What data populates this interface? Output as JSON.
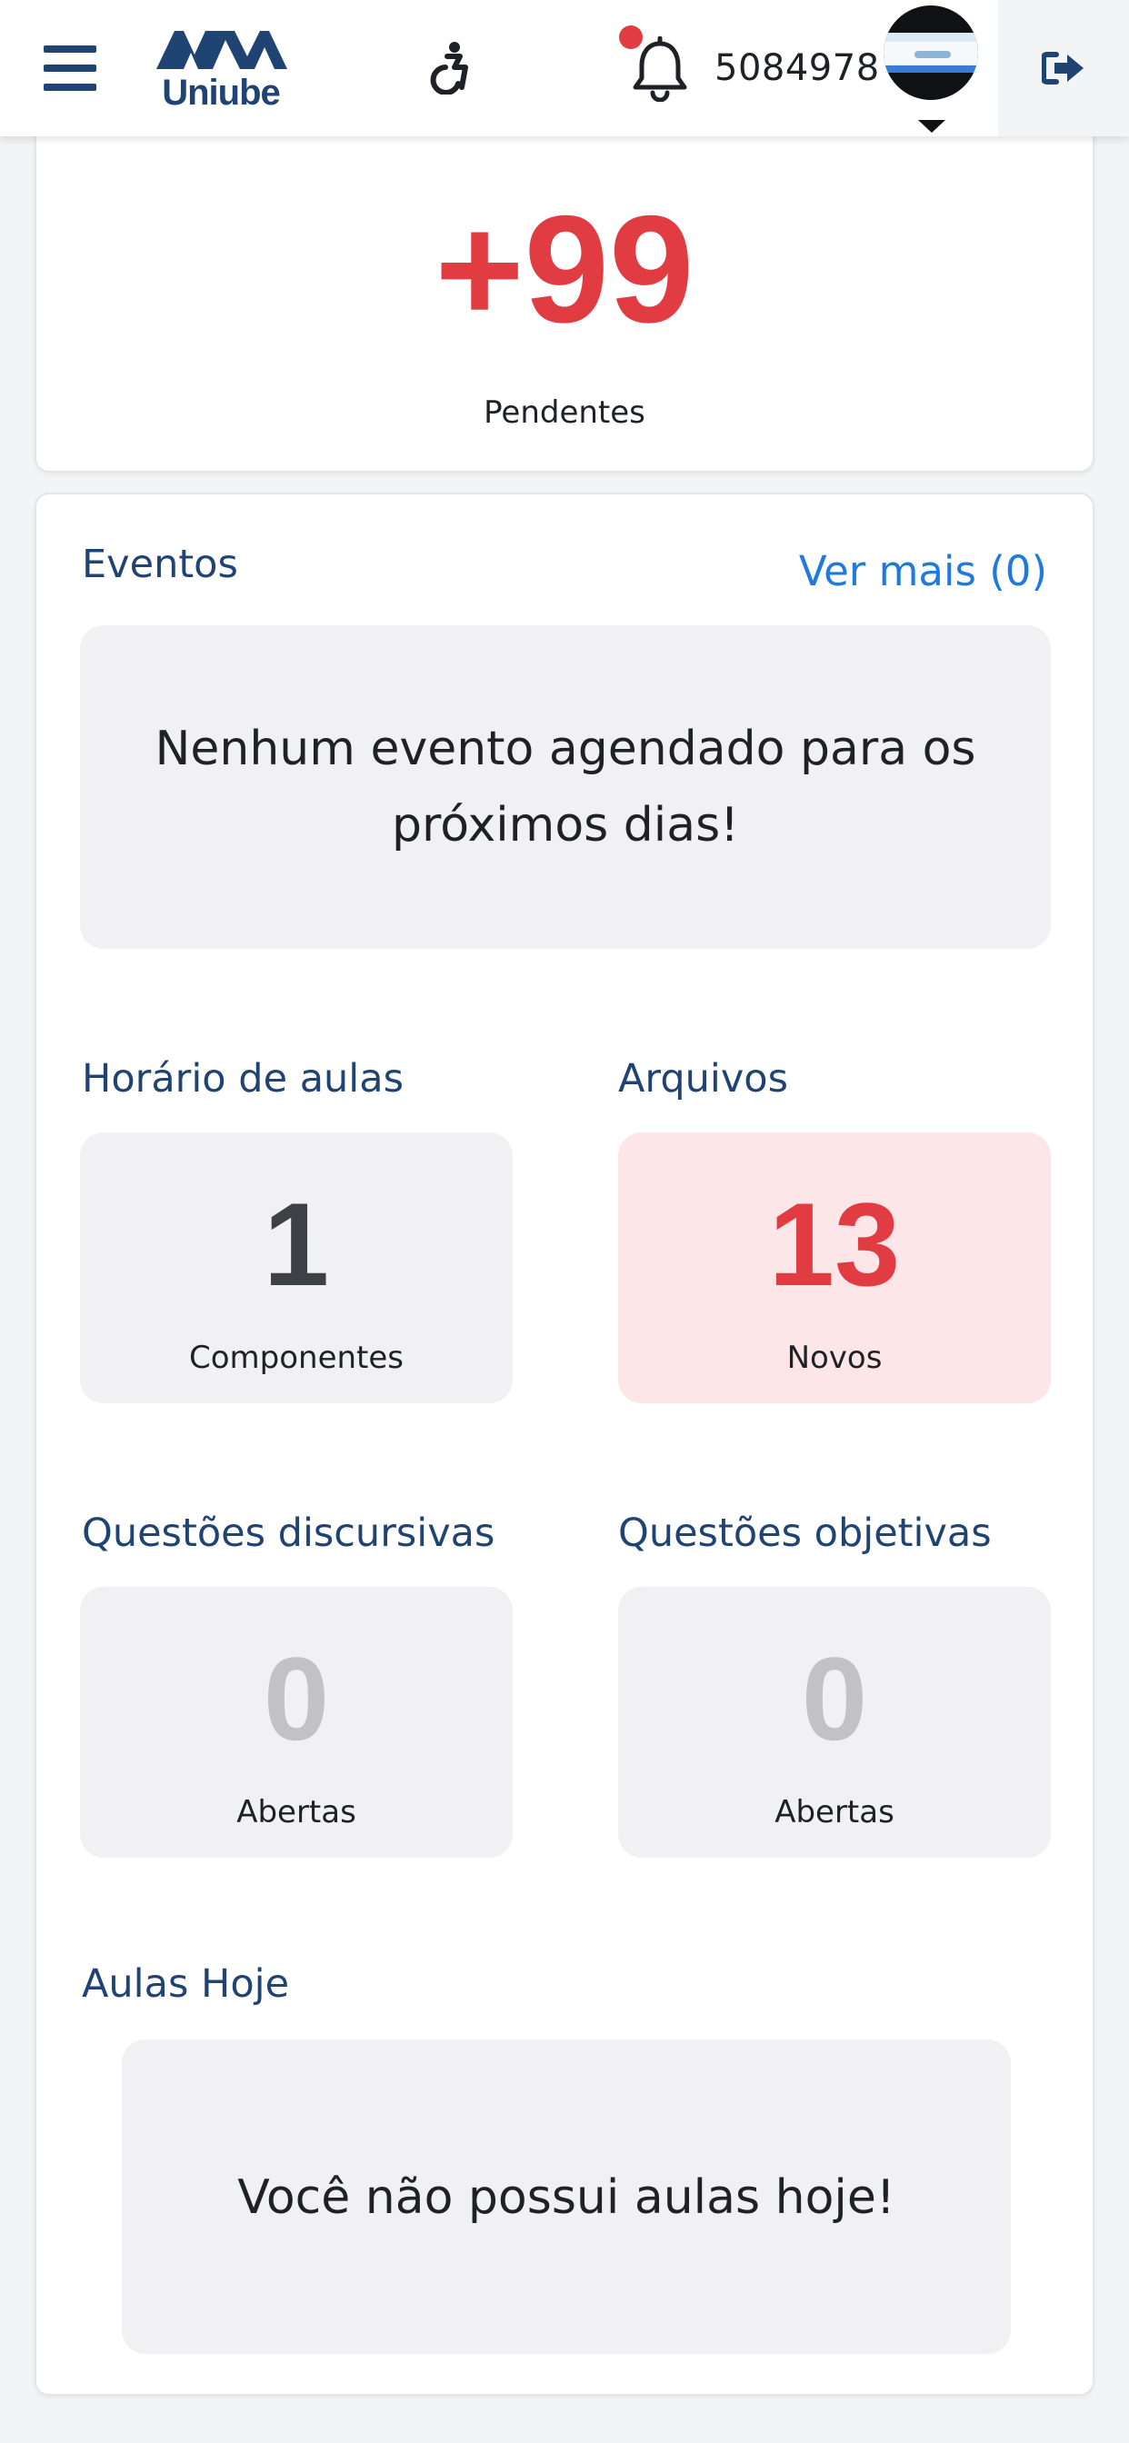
{
  "header": {
    "menu_icon": "hamburger-menu-icon",
    "logo_text": "Uniube",
    "logo_mark": "AVA",
    "accessibility_icon": "wheelchair-accessibility-icon",
    "notification_icon": "bell-icon",
    "user_id": "5084978",
    "logout_icon": "sign-out-icon"
  },
  "pending": {
    "value": "+99",
    "label": "Pendentes"
  },
  "events": {
    "title": "Eventos",
    "see_more": "Ver mais (0)",
    "empty_message_line1": "Nenhum evento agendado para os",
    "empty_message_line2": "próximos dias!"
  },
  "schedule": {
    "title": "Horário de aulas",
    "value": "1",
    "label": "Componentes"
  },
  "files": {
    "title": "Arquivos",
    "value": "13",
    "label": "Novos"
  },
  "essay_questions": {
    "title": "Questões discursivas",
    "value": "0",
    "label": "Abertas"
  },
  "objective_questions": {
    "title": "Questões objetivas",
    "value": "0",
    "label": "Abertas"
  },
  "classes_today": {
    "title": "Aulas Hoje",
    "empty_message": "Você não possui aulas hoje!"
  },
  "colors": {
    "brand_navy": "#1f4373",
    "accent_red": "#e23c43",
    "link_blue": "#1f7ae0",
    "box_grey": "#f1f1f3",
    "box_pink": "#fde6e8"
  }
}
